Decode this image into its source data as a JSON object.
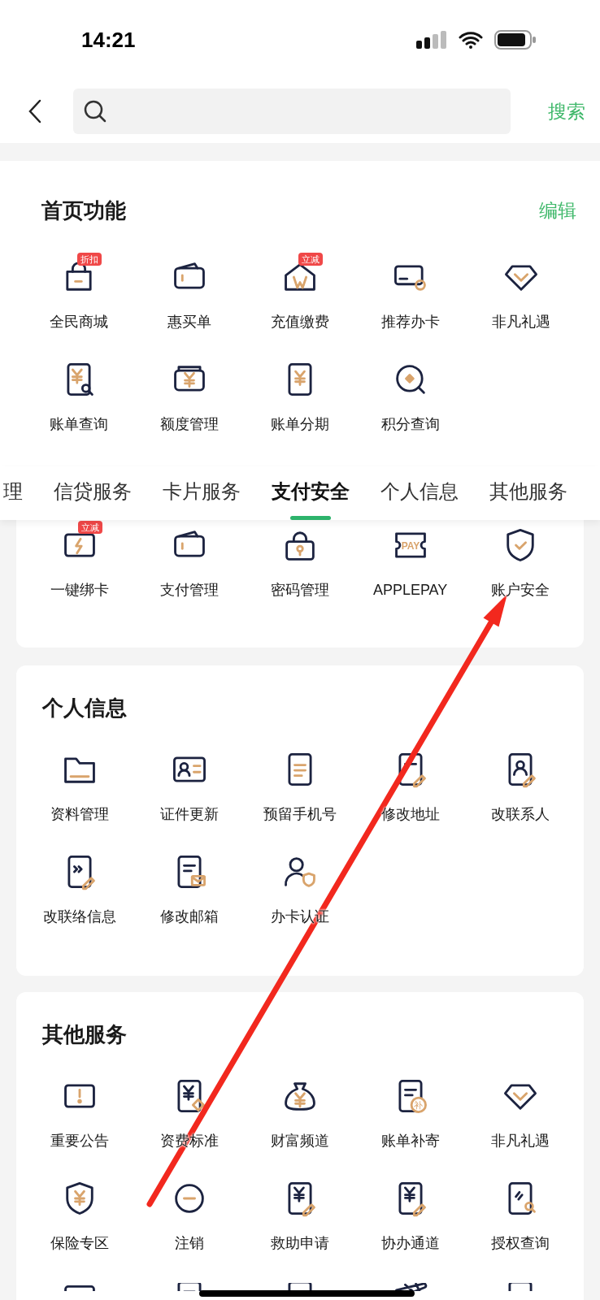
{
  "status_bar": {
    "time": "14:21"
  },
  "search": {
    "button": "搜索"
  },
  "home_functions": {
    "title": "首页功能",
    "edit": "编辑",
    "items": [
      {
        "label": "全民商城",
        "badge": "折扣"
      },
      {
        "label": "惠买单"
      },
      {
        "label": "充值缴费",
        "badge": "立减"
      },
      {
        "label": "推荐办卡"
      },
      {
        "label": "非凡礼遇"
      },
      {
        "label": "账单查询"
      },
      {
        "label": "额度管理"
      },
      {
        "label": "账单分期"
      },
      {
        "label": "积分查询"
      }
    ]
  },
  "tabs": [
    {
      "label": "理",
      "selected": false
    },
    {
      "label": "信贷服务",
      "selected": false
    },
    {
      "label": "卡片服务",
      "selected": false
    },
    {
      "label": "支付安全",
      "selected": true
    },
    {
      "label": "个人信息",
      "selected": false
    },
    {
      "label": "其他服务",
      "selected": false
    }
  ],
  "payment_security": {
    "items": [
      {
        "label": "一键绑卡",
        "badge": "立减"
      },
      {
        "label": "支付管理"
      },
      {
        "label": "密码管理"
      },
      {
        "label": "APPLEPAY",
        "icon_text": "PAY"
      },
      {
        "label": "账户安全"
      }
    ]
  },
  "personal_info": {
    "title": "个人信息",
    "items": [
      {
        "label": "资料管理"
      },
      {
        "label": "证件更新"
      },
      {
        "label": "预留手机号"
      },
      {
        "label": "修改地址"
      },
      {
        "label": "改联系人"
      },
      {
        "label": "改联络信息"
      },
      {
        "label": "修改邮箱"
      },
      {
        "label": "办卡认证"
      }
    ]
  },
  "other_services": {
    "title": "其他服务",
    "items": [
      {
        "label": "重要公告"
      },
      {
        "label": "资费标准"
      },
      {
        "label": "财富频道"
      },
      {
        "label": "账单补寄",
        "icon_text": "补"
      },
      {
        "label": "非凡礼遇"
      },
      {
        "label": "保险专区"
      },
      {
        "label": "注销"
      },
      {
        "label": "救助申请"
      },
      {
        "label": "协办通道"
      },
      {
        "label": "授权查询"
      }
    ]
  }
}
